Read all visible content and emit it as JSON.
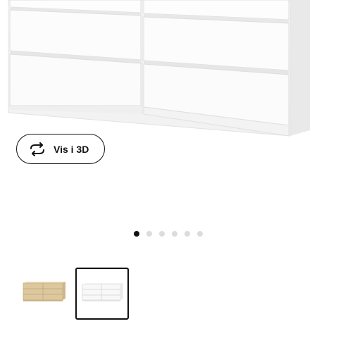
{
  "product": {
    "view_3d_label": "Vis i 3D",
    "view_3d_icon": "rotate-icon"
  },
  "gallery": {
    "image_count": 6,
    "active_index": 0,
    "colors": {
      "active_dot": "#111111",
      "inactive_dot": "#dcdcdc"
    }
  },
  "variants": [
    {
      "name": "birch-veneer-variant",
      "swatch": "#d9c49b",
      "selected": false
    },
    {
      "name": "white-variant",
      "swatch": "#ffffff",
      "selected": true
    }
  ]
}
